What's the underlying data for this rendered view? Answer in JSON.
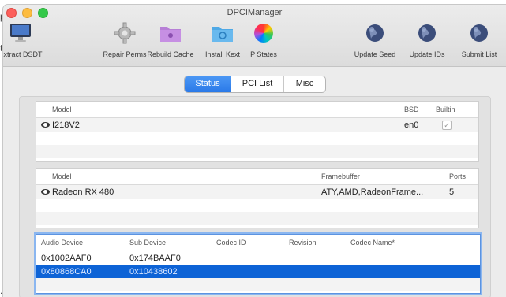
{
  "background": {
    "frag1": "p",
    "frag2": "ti",
    "frag3": "."
  },
  "window": {
    "title": "DPCIManager"
  },
  "toolbar": {
    "items": [
      {
        "label": "Extract DSDT",
        "icon": "monitor-icon"
      },
      {
        "label": "Repair Perms",
        "icon": "gear-icon"
      },
      {
        "label": "Rebuild Cache",
        "icon": "folder-icon"
      },
      {
        "label": "Install Kext",
        "icon": "download-folder-icon"
      },
      {
        "label": "P States",
        "icon": "color-wheel-icon"
      },
      {
        "label": "Update Seed",
        "icon": "globe-icon"
      },
      {
        "label": "Update IDs",
        "icon": "globe-icon"
      },
      {
        "label": "Submit List",
        "icon": "globe-icon"
      }
    ]
  },
  "tabs": {
    "items": [
      "Status",
      "PCI List",
      "Misc"
    ],
    "selected": "Status"
  },
  "network_table": {
    "headers": [
      "Model",
      "BSD",
      "Builtin"
    ],
    "rows": [
      {
        "model": "I218V2",
        "bsd": "en0",
        "builtin": "✓"
      }
    ]
  },
  "graphics_table": {
    "headers": [
      "Model",
      "Framebuffer",
      "Ports"
    ],
    "rows": [
      {
        "model": "Radeon RX 480",
        "framebuffer": "ATY,AMD,RadeonFrame...",
        "ports": "5"
      }
    ]
  },
  "audio_table": {
    "headers": [
      "Audio Device",
      "Sub Device",
      "Codec ID",
      "Revision",
      "Codec Name*"
    ],
    "rows": [
      {
        "audio_device": "0x1002AAF0",
        "sub_device": "0x174BAAF0",
        "codec_id": "",
        "revision": "",
        "codec_name": ""
      },
      {
        "audio_device": "0x80868CA0",
        "sub_device": "0x10438602",
        "codec_id": "",
        "revision": "",
        "codec_name": ""
      }
    ],
    "selected_row": 1
  },
  "colors": {
    "accent": "#2a79e8",
    "selection": "#0d63d6"
  }
}
